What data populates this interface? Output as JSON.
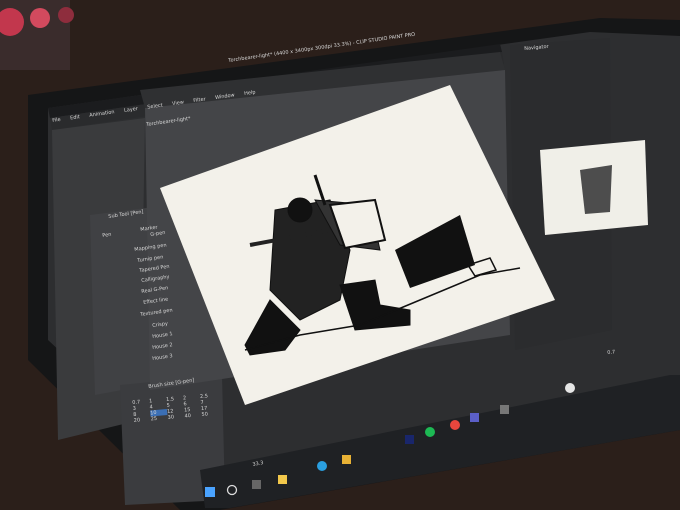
{
  "window": {
    "title": "Torchbearer-light* (4400 x 3400px 300dpi 33.3%) - CLIP STUDIO PAINT PRO"
  },
  "menu": [
    "File",
    "Edit",
    "Animation",
    "Layer",
    "Select",
    "View",
    "Filter",
    "Window",
    "Help"
  ],
  "canvas_tab": "Torchbearer-light*",
  "navigator": {
    "title": "Navigator"
  },
  "subtool": {
    "title": "Sub Tool [Pen]",
    "tabs": [
      "Pen",
      "Marker"
    ],
    "brushes": [
      "G-pen",
      "Mapping pen",
      "Turnip pen",
      "Tapered Pen",
      "Calligraphy",
      "Real G-Pen",
      "Effect line",
      "Textured pen",
      "Crispy",
      "House 1",
      "House 2",
      "House 3"
    ]
  },
  "brush_size": {
    "title": "Brush size [G-pen]",
    "values": [
      "0.7",
      "1",
      "1.5",
      "2",
      "2.5",
      "3",
      "4",
      "5",
      "6",
      "7",
      "8",
      "10",
      "12",
      "15",
      "17",
      "20",
      "25",
      "30",
      "40",
      "50"
    ]
  },
  "canvas_zoom": "33.3",
  "navigator_zoom": "0.7",
  "colors": {
    "background": "#2b1f1a",
    "bezel": "#151617",
    "ui_panel": "#3a3b3d",
    "canvas_paper": "#f3f1ea",
    "taskbar": "#1f2124"
  },
  "taskbar_icons": [
    "start-icon",
    "search-icon",
    "task-view-icon",
    "file-explorer-icon",
    "edge-icon",
    "folder-icon",
    "photoshop-icon",
    "spotify-icon",
    "chrome-icon",
    "teams-icon",
    "store-icon",
    "clip-studio-icon"
  ]
}
